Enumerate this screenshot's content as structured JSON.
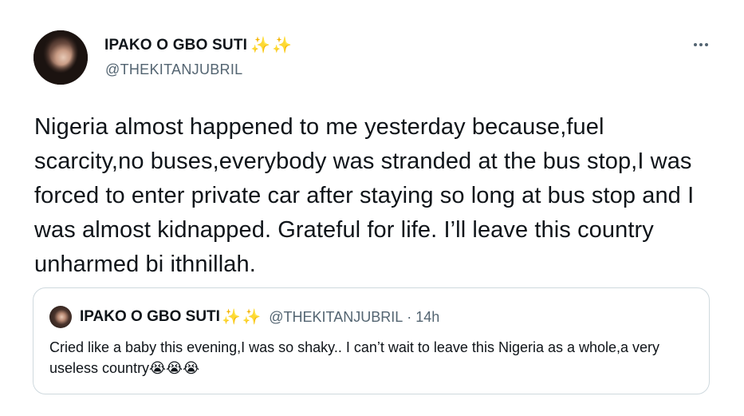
{
  "tweet": {
    "display_name": "IPAKO O GBO SUTI",
    "name_emoji": "✨✨",
    "handle": "@THEKITANJUBRIL",
    "text": "Nigeria almost happened to me yesterday because,fuel scarcity,no buses,everybody was stranded at the bus stop,I was forced to enter private car after staying so long at bus stop and I was almost kidnapped. Grateful for life. I’ll leave this country unharmed bi ithnillah."
  },
  "quote": {
    "display_name": "IPAKO O GBO SUTI",
    "name_emoji": "✨✨",
    "handle": "@THEKITANJUBRIL",
    "separator": "·",
    "time": "14h",
    "text": "Cried like a baby this evening,I was so shaky.. I can’t wait to leave this Nigeria as a whole,a very useless country😭😭😭"
  },
  "icons": {
    "more": "more-horizontal-icon"
  }
}
